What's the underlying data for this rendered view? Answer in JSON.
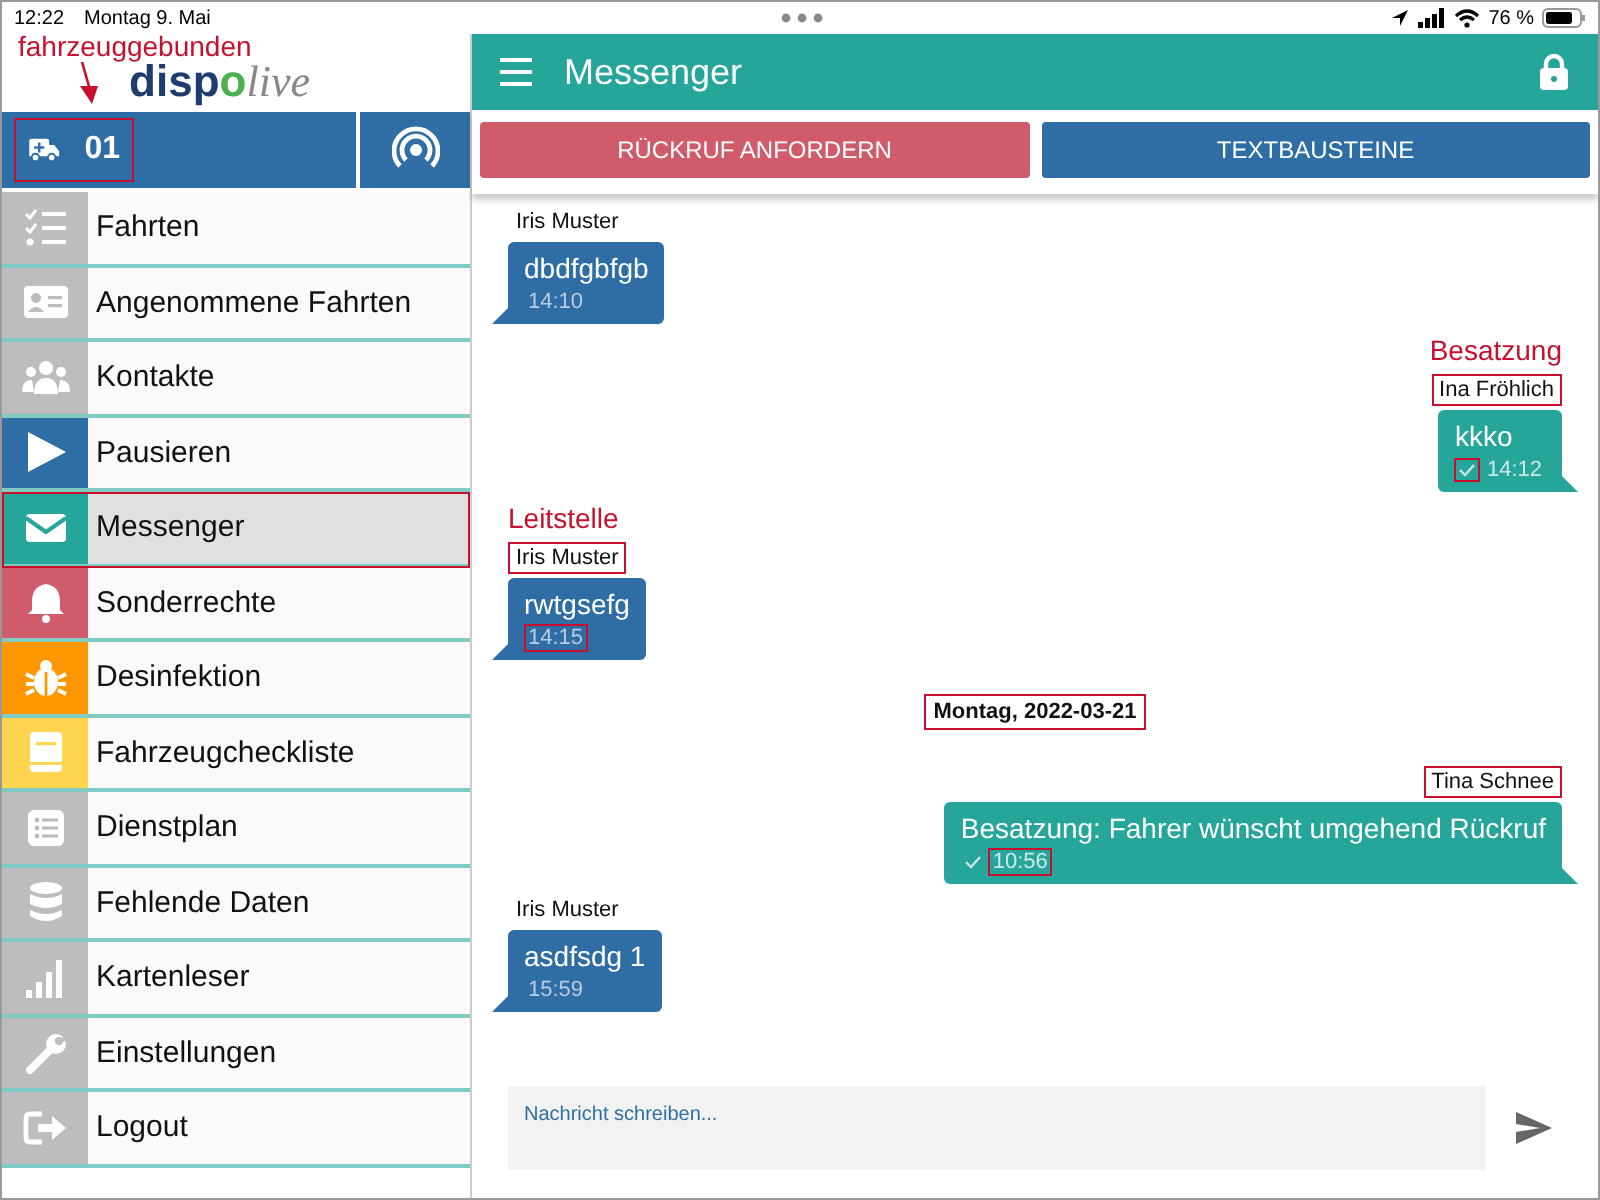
{
  "status_bar": {
    "time": "12:22",
    "date": "Montag 9. Mai",
    "battery": "76 %"
  },
  "sidebar": {
    "annotation": "fahrzeuggebunden",
    "logo": [
      "disp",
      "o",
      "live"
    ],
    "unit": {
      "label": "01",
      "highlighted": true
    },
    "items": [
      {
        "label": "Fahrten",
        "kind": "checklist",
        "color": "#bdbdbd",
        "selected": false,
        "highlighted": false
      },
      {
        "label": "Angenommene Fahrten",
        "kind": "card",
        "color": "#bdbdbd",
        "selected": false,
        "highlighted": false
      },
      {
        "label": "Kontakte",
        "kind": "people",
        "color": "#bdbdbd",
        "selected": false,
        "highlighted": false
      },
      {
        "label": "Pausieren",
        "kind": "play",
        "color": "#2f6ea5",
        "selected": false,
        "highlighted": false
      },
      {
        "label": "Messenger",
        "kind": "mail",
        "color": "#26a69a",
        "selected": true,
        "highlighted": true
      },
      {
        "label": "Sonderrechte",
        "kind": "bell",
        "color": "#cf5b6b",
        "selected": false,
        "highlighted": false
      },
      {
        "label": "Desinfektion",
        "kind": "bug",
        "color": "#ff9800",
        "selected": false,
        "highlighted": false
      },
      {
        "label": "Fahrzeugcheckliste",
        "kind": "book",
        "color": "#ffd54f",
        "selected": false,
        "highlighted": false
      },
      {
        "label": "Dienstplan",
        "kind": "listbox",
        "color": "#bdbdbd",
        "selected": false,
        "highlighted": false
      },
      {
        "label": "Fehlende Daten",
        "kind": "database",
        "color": "#bdbdbd",
        "selected": false,
        "highlighted": false
      },
      {
        "label": "Kartenleser",
        "kind": "signal",
        "color": "#bdbdbd",
        "selected": false,
        "highlighted": false
      },
      {
        "label": "Einstellungen",
        "kind": "wrench",
        "color": "#bdbdbd",
        "selected": false,
        "highlighted": false
      },
      {
        "label": "Logout",
        "kind": "logout",
        "color": "#bdbdbd",
        "selected": false,
        "highlighted": false
      }
    ]
  },
  "header": {
    "title": "Messenger"
  },
  "buttons": [
    {
      "label": "RÜCKRUF ANFORDERN",
      "kind": "callback"
    },
    {
      "label": "TEXTBAUSTEINE",
      "kind": "snippets"
    }
  ],
  "chat": [
    {
      "kind": "message",
      "outgoing": false,
      "sender": "Iris Muster",
      "sender_highlighted": false,
      "text": "dbdfgbfgb",
      "time": "14:10",
      "time_highlighted": false
    },
    {
      "kind": "message",
      "annotation": "Besatzung",
      "outgoing": true,
      "sender": "Ina Fröhlich",
      "sender_highlighted": true,
      "text": "kkko",
      "time": "14:12",
      "time_highlighted": false,
      "check_highlighted": true
    },
    {
      "kind": "message",
      "annotation": "Leitstelle",
      "outgoing": false,
      "sender": "Iris Muster",
      "sender_highlighted": true,
      "text": "rwtgsefg",
      "time": "14:15",
      "time_highlighted": true
    },
    {
      "kind": "date",
      "text": "Montag, 2022-03-21",
      "highlighted": true
    },
    {
      "kind": "message",
      "outgoing": true,
      "sender": "Tina Schnee",
      "sender_highlighted": true,
      "text": "Besatzung: Fahrer wünscht umgehend Rückruf",
      "time": "10:56",
      "time_highlighted": true,
      "check_highlighted": false
    },
    {
      "kind": "message",
      "outgoing": false,
      "sender": "Iris Muster",
      "sender_highlighted": false,
      "text": "asdfsdg 1",
      "time": "15:59",
      "time_highlighted": false
    }
  ],
  "composer": {
    "placeholder": "Nachricht schreiben..."
  }
}
